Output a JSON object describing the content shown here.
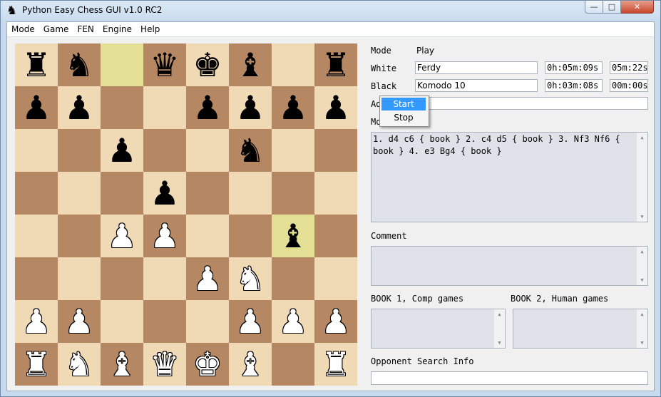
{
  "window": {
    "title": "Python Easy Chess GUI v1.0 RC2",
    "controls": {
      "minimize": "—",
      "maximize": "□",
      "close": "✕"
    }
  },
  "menu": [
    "Mode",
    "Game",
    "FEN",
    "Engine",
    "Help"
  ],
  "board": {
    "light_color": "#f0d9b5",
    "dark_color": "#b58863",
    "highlight_color": "#e3df95",
    "ranks": [
      [
        [
          "b",
          "♜"
        ],
        null,
        [
          "b",
          "♞"
        ],
        null,
        [
          "hl",
          ""
        ],
        null,
        [
          "b",
          "♛"
        ],
        null,
        [
          "b",
          "♚"
        ],
        null,
        [
          "b",
          "♝"
        ],
        null,
        [
          "",
          ""
        ],
        null,
        [
          "b",
          "♜"
        ]
      ],
      [
        [
          "b",
          "♟"
        ],
        [
          "b",
          "♟"
        ],
        [
          "",
          ""
        ],
        [
          "",
          ""
        ],
        [
          "b",
          "♟"
        ],
        [
          "b",
          "♟"
        ],
        [
          "b",
          "♟"
        ],
        [
          "b",
          "♟"
        ]
      ]
    ],
    "squares": [
      [
        "b♜",
        "b♞",
        "hl:",
        "b♛",
        "b♚",
        "b♝",
        "",
        "b♜"
      ],
      [
        "b♟",
        "b♟",
        "",
        "",
        "b♟",
        "b♟",
        "b♟",
        "b♟"
      ],
      [
        "",
        "",
        "b♟",
        "",
        "",
        "b♞",
        "",
        ""
      ],
      [
        "",
        "",
        "",
        "b♟",
        "",
        "",
        "",
        ""
      ],
      [
        "",
        "",
        "w♙",
        "w♙",
        "",
        "",
        "hlb♝",
        ""
      ],
      [
        "",
        "",
        "",
        "",
        "w♙",
        "w♘",
        "",
        ""
      ],
      [
        "w♙",
        "w♙",
        "",
        "",
        "",
        "w♙",
        "w♙",
        "w♙"
      ],
      [
        "w♖",
        "w♘",
        "w♗",
        "w♕",
        "w♔",
        "w♗",
        "",
        "w♖"
      ]
    ]
  },
  "panel": {
    "mode_label": "Mode",
    "mode_value": "Play",
    "white_label": "White",
    "white_name": "Ferdy",
    "white_clock": "0h:05m:09s",
    "white_increment": "05m:22s",
    "black_label": "Black",
    "black_name": "Komodo 10",
    "black_clock": "0h:03m:08s",
    "black_increment": "00m:00s",
    "adviser_label": "Ad",
    "moves_label": "Mo",
    "moves_text": "1. d4 c6 { book } 2. c4 d5 { book } 3. Nf3 Nf6 { book } 4. e3 Bg4 { book }",
    "comment_label": "Comment",
    "book1_label": "BOOK 1, Comp games",
    "book2_label": "BOOK 2, Human games",
    "search_info_label": "Opponent Search Info"
  },
  "popup": {
    "items": [
      "Start",
      "Stop"
    ],
    "selected": "Start",
    "selected_color": "#3399ff"
  }
}
